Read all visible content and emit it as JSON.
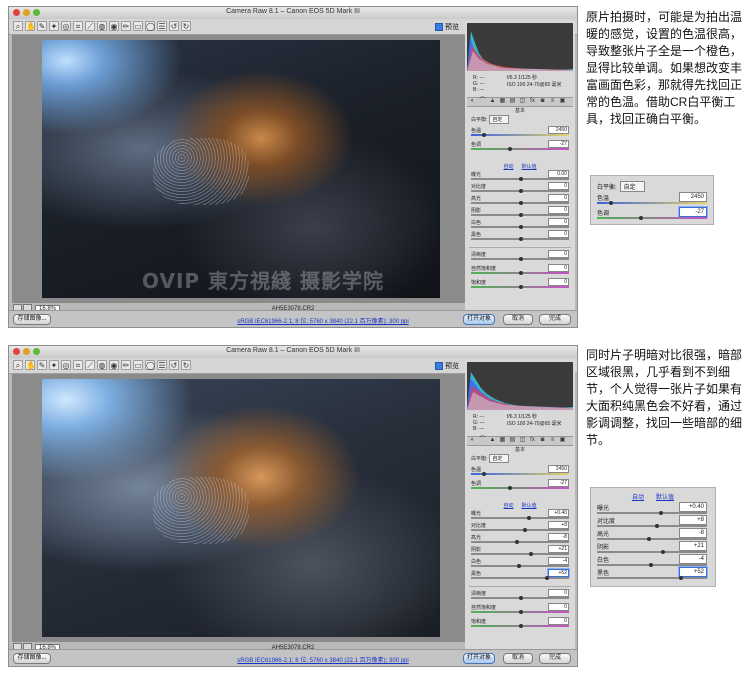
{
  "window": {
    "title": "Camera Raw 8.1 – Canon EOS 5D Mark III",
    "preview_label": "预览",
    "zoom_value": "16.8%",
    "filename": "AH5E3078.CR2",
    "workflow_link": "sRGB IEC61966-2.1; 8 位; 5760 x 3840 (22.1 百万像素); 300 ppi",
    "buttons": {
      "save": "存储图像...",
      "open": "打开对象",
      "cancel": "取消",
      "done": "完成"
    }
  },
  "camera_info": {
    "r": "R: ---",
    "g": "G: ---",
    "b": "B: ---",
    "exposure": "f/6.3   1/125 秒",
    "iso": "ISO 100   24-70@65 毫米"
  },
  "panel": {
    "section_title": "基本",
    "wb_label": "白平衡:",
    "wb_value": "自定",
    "auto_link": "自动",
    "default_link": "默认值"
  },
  "screenshot1": {
    "temperature": {
      "label": "色温",
      "value": "2450",
      "pos": 0.12
    },
    "tint": {
      "label": "色调",
      "value": "-27",
      "pos": 0.38
    },
    "sliders": [
      {
        "label": "曝光",
        "value": "0.00",
        "pos": 0.5
      },
      {
        "label": "对比度",
        "value": "0",
        "pos": 0.5
      },
      {
        "label": "高光",
        "value": "0",
        "pos": 0.5
      },
      {
        "label": "阴影",
        "value": "0",
        "pos": 0.5
      },
      {
        "label": "白色",
        "value": "0",
        "pos": 0.5
      },
      {
        "label": "黑色",
        "value": "0",
        "pos": 0.5
      }
    ],
    "presence": [
      {
        "label": "清晰度",
        "value": "0"
      },
      {
        "label": "自然饱和度",
        "value": "0"
      },
      {
        "label": "饱和度",
        "value": "0"
      }
    ],
    "watermark": "OVIP 東方視綫 摄影学院",
    "caption": "原片拍摄时，可能是为拍出温暖的感觉，设置的色温很高，导致整张片子全是一个橙色，显得比较单调。如果想改变丰富画面色彩，那就得先找回正常的色温。借助CR白平衡工具，找回正确白平衡。"
  },
  "screenshot2": {
    "temperature": {
      "label": "色温",
      "value": "2450",
      "pos": 0.12
    },
    "tint": {
      "label": "色调",
      "value": "-27",
      "pos": 0.38
    },
    "sliders": [
      {
        "label": "曝光",
        "value": "+0.40",
        "pos": 0.58
      },
      {
        "label": "对比度",
        "value": "+8",
        "pos": 0.54
      },
      {
        "label": "高光",
        "value": "-8",
        "pos": 0.46
      },
      {
        "label": "阴影",
        "value": "+21",
        "pos": 0.6
      },
      {
        "label": "白色",
        "value": "-4",
        "pos": 0.48
      },
      {
        "label": "黑色",
        "value": "+52",
        "pos": 0.76
      }
    ],
    "presence": [
      {
        "label": "清晰度",
        "value": "0"
      },
      {
        "label": "自然饱和度",
        "value": "0"
      },
      {
        "label": "饱和度",
        "value": "0"
      }
    ],
    "caption": "同时片子明暗对比很强，暗部区域很黑，几乎看到不到细节，个人觉得一张片子如果有大面积纯黑色会不好看，通过影调调整，找回一些暗部的细节。"
  },
  "colors": {
    "accent_blue": "#1a37c4",
    "panel_bg": "#d9d9d9"
  }
}
